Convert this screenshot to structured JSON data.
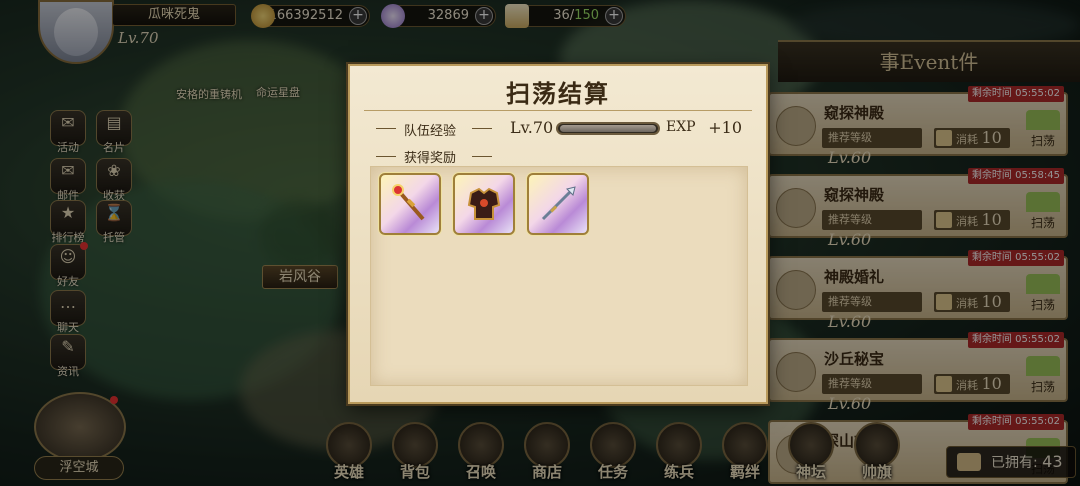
{
  "player": {
    "name": "瓜咪死鬼",
    "level": "Lv.70"
  },
  "resources": [
    {
      "icon": "gold-coin-icon",
      "value": "166392512",
      "color": "#e2b84a"
    },
    {
      "icon": "gem-icon",
      "value": "32869",
      "color": "#b8a0e6"
    },
    {
      "icon": "stamina-icon",
      "value_current": "36/",
      "value_max": "150",
      "color": "#e8d7a2"
    }
  ],
  "sidebar": [
    {
      "label": "活动",
      "icon": "scroll-icon",
      "glyph": "✉"
    },
    {
      "label": "名片",
      "icon": "card-icon",
      "glyph": "▤"
    },
    {
      "label": "邮件",
      "icon": "mail-icon",
      "glyph": "✉"
    },
    {
      "label": "收获",
      "icon": "harvest-icon",
      "glyph": "❀"
    },
    {
      "label": "排行榜",
      "icon": "ranking-icon",
      "glyph": "★"
    },
    {
      "label": "托管",
      "icon": "hourglass-icon",
      "glyph": "⌛"
    },
    {
      "label": "好友",
      "icon": "friends-icon",
      "glyph": "☺"
    },
    {
      "label": "聊天",
      "icon": "chat-icon",
      "glyph": "…"
    },
    {
      "label": "资讯",
      "icon": "news-icon",
      "glyph": "✎"
    }
  ],
  "map": {
    "labels": [
      "安格的重铸机",
      "命运星盘",
      "岩风谷"
    ],
    "city_label": "浮空城"
  },
  "bottom_nav": [
    {
      "label": "英雄",
      "icon": "hero-icon"
    },
    {
      "label": "背包",
      "icon": "bag-icon"
    },
    {
      "label": "召唤",
      "icon": "summon-icon"
    },
    {
      "label": "商店",
      "icon": "shop-icon"
    },
    {
      "label": "任务",
      "icon": "quest-icon"
    },
    {
      "label": "练兵",
      "icon": "training-icon"
    },
    {
      "label": "羁绊",
      "icon": "bond-icon"
    },
    {
      "label": "神坛",
      "icon": "altar-icon"
    },
    {
      "label": "帅旗",
      "icon": "banner-icon"
    }
  ],
  "owned": {
    "label": "已拥有:",
    "value": "43"
  },
  "events": {
    "header": "事Event件",
    "items": [
      {
        "timer": "剩余时间 05:55:02",
        "title": "窥探神殿",
        "rec_label": "推荐等级",
        "rec_level": "Lv.60",
        "cost_label": "消耗",
        "cost": "10",
        "action": "扫荡"
      },
      {
        "timer": "剩余时间 05:58:45",
        "title": "窥探神殿",
        "rec_label": "推荐等级",
        "rec_level": "Lv.60",
        "cost_label": "消耗",
        "cost": "10",
        "action": "扫荡"
      },
      {
        "timer": "剩余时间 05:55:02",
        "title": "神殿婚礼",
        "rec_label": "推荐等级",
        "rec_level": "Lv.60",
        "cost_label": "消耗",
        "cost": "10",
        "action": "扫荡"
      },
      {
        "timer": "剩余时间 05:55:02",
        "title": "沙丘秘宝",
        "rec_label": "推荐等级",
        "rec_level": "Lv.60",
        "cost_label": "消耗",
        "cost": "10",
        "action": "扫荡"
      },
      {
        "timer": "剩余时间 05:55:02",
        "title": "深山古墓",
        "rec_label": "推荐等级",
        "rec_level": "Lv.60",
        "cost_label": "消耗",
        "cost": "10",
        "action": "扫荡"
      }
    ]
  },
  "modal": {
    "title": "扫荡结算",
    "team_exp_label": "队伍经验",
    "team_level": "Lv.70",
    "exp_fill": 1.0,
    "exp_unit": "EXP",
    "exp_gain": "+10",
    "rewards_label": "获得奖励",
    "rewards": [
      {
        "icon": "staff-icon"
      },
      {
        "icon": "armor-icon"
      },
      {
        "icon": "spear-icon"
      }
    ]
  }
}
